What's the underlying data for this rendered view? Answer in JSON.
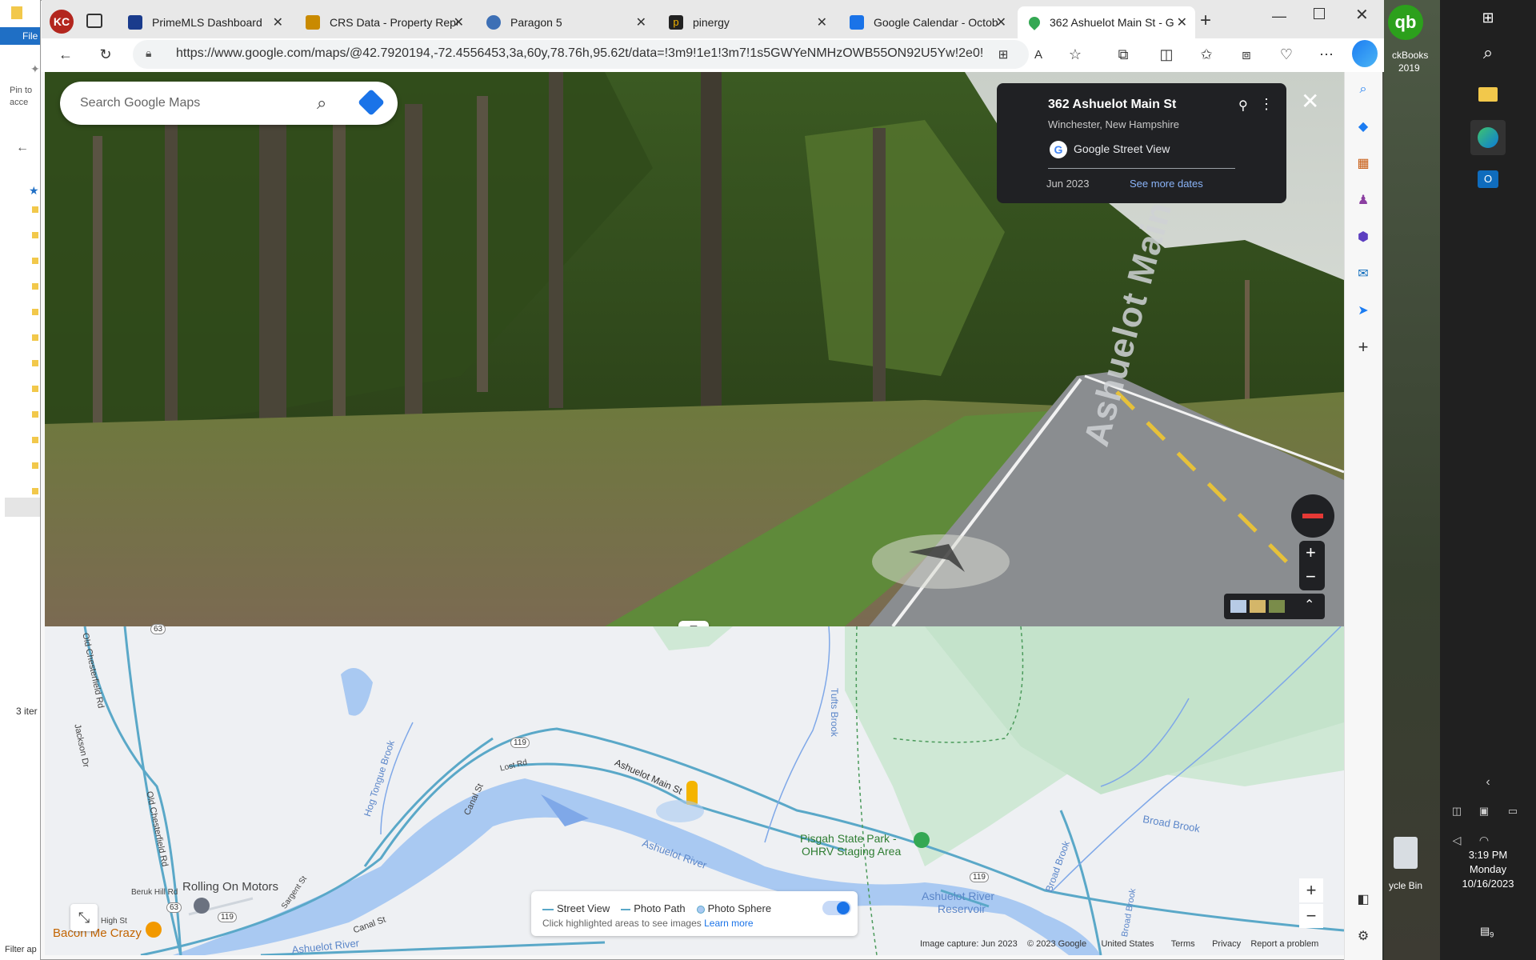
{
  "explorer": {
    "file_label": "File",
    "pin_label": "Pin to",
    "pin_label2": "acce",
    "items_label": "3 iter",
    "filter_label": "Filter ap"
  },
  "browser": {
    "tabs": [
      {
        "title": "PrimeMLS Dashboard",
        "color": "#1a3b8c"
      },
      {
        "title": "CRS Data - Property Repc",
        "color": "#c98a00"
      },
      {
        "title": "Paragon 5",
        "color": "#3d6fb5"
      },
      {
        "title": "pinergy",
        "color": "#222222"
      },
      {
        "title": "Google Calendar - Octob",
        "color": "#1a73e8"
      },
      {
        "title": "362 Ashuelot Main St - G",
        "color": "#34a853"
      }
    ],
    "url": "https://www.google.com/maps/@42.7920194,-72.4556453,3a,60y,78.76h,95.62t/data=!3m9!1e1!3m7!1s5GWYeNMHzOWB55ON92U5Yw!2e0!7i1..."
  },
  "streetview": {
    "search_placeholder": "Search Google Maps",
    "address_title": "362 Ashuelot Main St",
    "address_sub": "Winchester, New Hampshire",
    "source_label": "Google Street View",
    "date_label": "Jun 2023",
    "more_dates_label": "See more dates",
    "road_label": "Ashuelot Main St"
  },
  "map": {
    "labels": {
      "old_chesterfield_1": "Old Chesterfield Rd",
      "old_chesterfield_2": "Old Chesterfield Rd",
      "jackson": "Jackson Dr",
      "hog_tongue": "Hog Tongue Brook",
      "canal_st": "Canal St",
      "canal_st2": "Canal St",
      "lost_rd": "Lost Rd",
      "ashuelot_main": "Ashuelot Main St",
      "tufts": "Tufts Brook",
      "ashuelot_river": "Ashuelot River",
      "ashuelot_river2": "Ashuelot River",
      "pisgah1": "Pisgah State Park -",
      "pisgah2": "OHRV Staging Area",
      "broad_brook": "Broad Brook",
      "broad_brook2": "Broad Brook",
      "broad_brook3": "Broad Brook",
      "reservoir1": "Ashuelot River",
      "reservoir2": "Reservoir",
      "rolling": "Rolling On Motors",
      "bacon": "Bacon Me Crazy",
      "beruk": "Beruk Hill Rd",
      "high_st": "High St",
      "sargent": "Sargent St",
      "r63": "63",
      "r63b": "63",
      "r119a": "119",
      "r119b": "119",
      "r119c": "119"
    },
    "legend": {
      "street_view": "Street View",
      "photo_path": "Photo Path",
      "photo_sphere": "Photo Sphere",
      "hint": "Click highlighted areas to see images",
      "learn_more": "Learn more"
    },
    "footer": {
      "capture": "Image capture: Jun 2023",
      "copyright": "© 2023 Google",
      "country": "United States",
      "terms": "Terms",
      "privacy": "Privacy",
      "report": "Report a problem"
    }
  },
  "taskbar": {
    "quickbooks_label": "ckBooks",
    "quickbooks_year": "2019",
    "recycle_label": "ycle Bin",
    "time": "3:19 PM",
    "day": "Monday",
    "date": "10/16/2023",
    "notif_count": "9"
  }
}
